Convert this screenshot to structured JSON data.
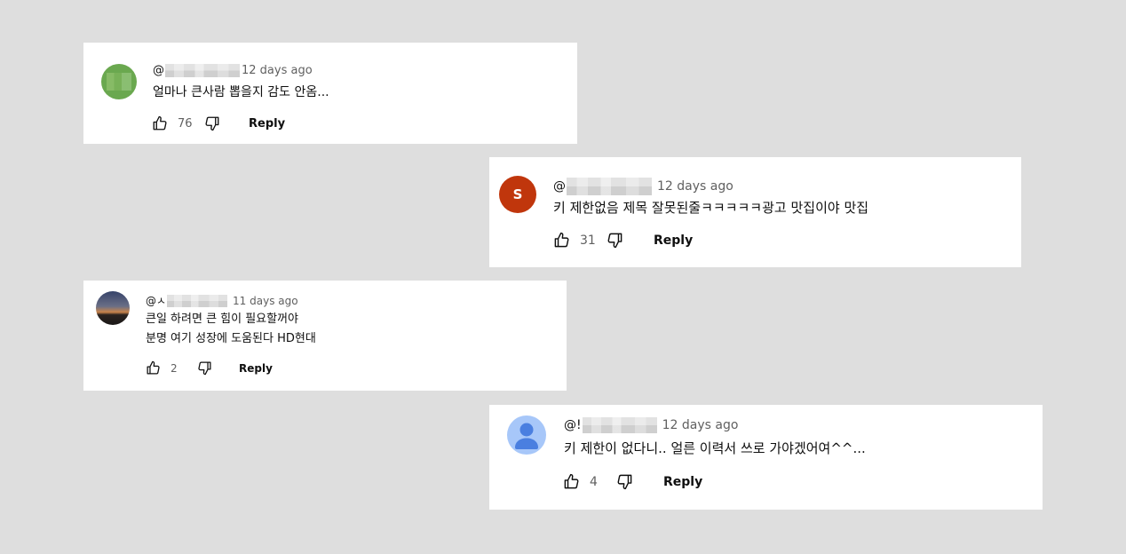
{
  "comments": [
    {
      "handle_prefix": "@",
      "time": "12 days ago",
      "lines": [
        "얼마나 큰사람 뽑을지 감도 안옴..."
      ],
      "likes": "76",
      "reply_label": "Reply",
      "avatar_color": "#6aa84f"
    },
    {
      "handle_prefix": "@",
      "time": "12 days ago",
      "lines": [
        "키 제한없음 제목 잘못된줄ㅋㅋㅋㅋㅋ광고 맛집이야 맛집"
      ],
      "likes": "31",
      "reply_label": "Reply",
      "avatar_letter": "S",
      "avatar_color": "#c0360c"
    },
    {
      "handle_prefix": "@ㅅ",
      "time": "11 days ago",
      "lines": [
        "큰일 하려면 큰 힘이 필요할꺼야",
        "분명 여기 성장에 도움된다 HD현대"
      ],
      "likes": "2",
      "reply_label": "Reply"
    },
    {
      "handle_prefix": "@!",
      "time": "12 days ago",
      "lines": [
        "키 제한이 없다니.. 얼른 이력서 쓰로 가야겠어여^^..."
      ],
      "likes": "4",
      "reply_label": "Reply",
      "avatar_color": "#a7c7f9"
    }
  ]
}
